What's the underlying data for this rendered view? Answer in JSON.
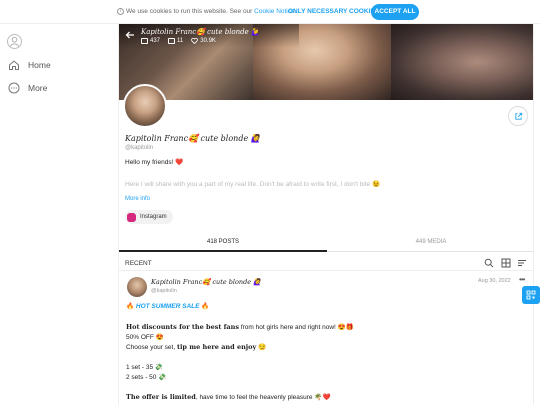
{
  "cookie": {
    "info_icon": "i",
    "text": "We use cookies to run this website. See our",
    "link": "Cookie Notice",
    "dot": ".",
    "only_necessary": "ONLY NECESSARY COOKIES",
    "accept": "ACCEPT ALL"
  },
  "sidebar": {
    "items": [
      {
        "label": "Home",
        "icon": "home-icon"
      },
      {
        "label": "More",
        "icon": "more-icon"
      }
    ]
  },
  "cover": {
    "name": "Kapitolin Franc🥰 cute blonde 🙋‍♀️",
    "stats": {
      "photos": "437",
      "videos": "11",
      "likes": "30.9K"
    }
  },
  "profile": {
    "name": "Kapitolin Franc🥰 cute blonde 🙋‍♀️",
    "handle": "@kapitolin",
    "bio_line1": "Hello my friends! ❤️",
    "bio_line2": "Here I will share with you a part of my real life. Don't be afraid to write first, I don't bite 😉",
    "more_info": "More info",
    "instagram": "Instagram"
  },
  "tabs": {
    "posts": "418 POSTS",
    "media": "449 MEDIA"
  },
  "feed": {
    "header": "RECENT",
    "post": {
      "name": "Kapitolin Franc🥰 cute blonde 🙋‍♀️",
      "handle": "@kapitolin",
      "date": "Aug 30, 2022",
      "menu": "•••",
      "line1_prefix": "🔥",
      "line1_hot": "HOT SUMMER SALE",
      "line1_suffix": "🔥",
      "line2_bold": "Hot discounts for the best fans",
      "line2_rest": " from hot girls here and right now! 😍🎁",
      "line3": "50% OFF 😍",
      "line4_prefix": "Choose your set, ",
      "line4_bold": "tip me here and enjoy",
      "line4_suffix": " 😏",
      "line5": "1 set - 35 💸",
      "line6": "2 sets - 50 💸",
      "line7_bold": "The offer is limited",
      "line7_rest": ", have time to feel the heavenly pleasure 🌴❤️"
    }
  },
  "colors": {
    "accent": "#1da1f2",
    "instagram": "#d6287e"
  }
}
